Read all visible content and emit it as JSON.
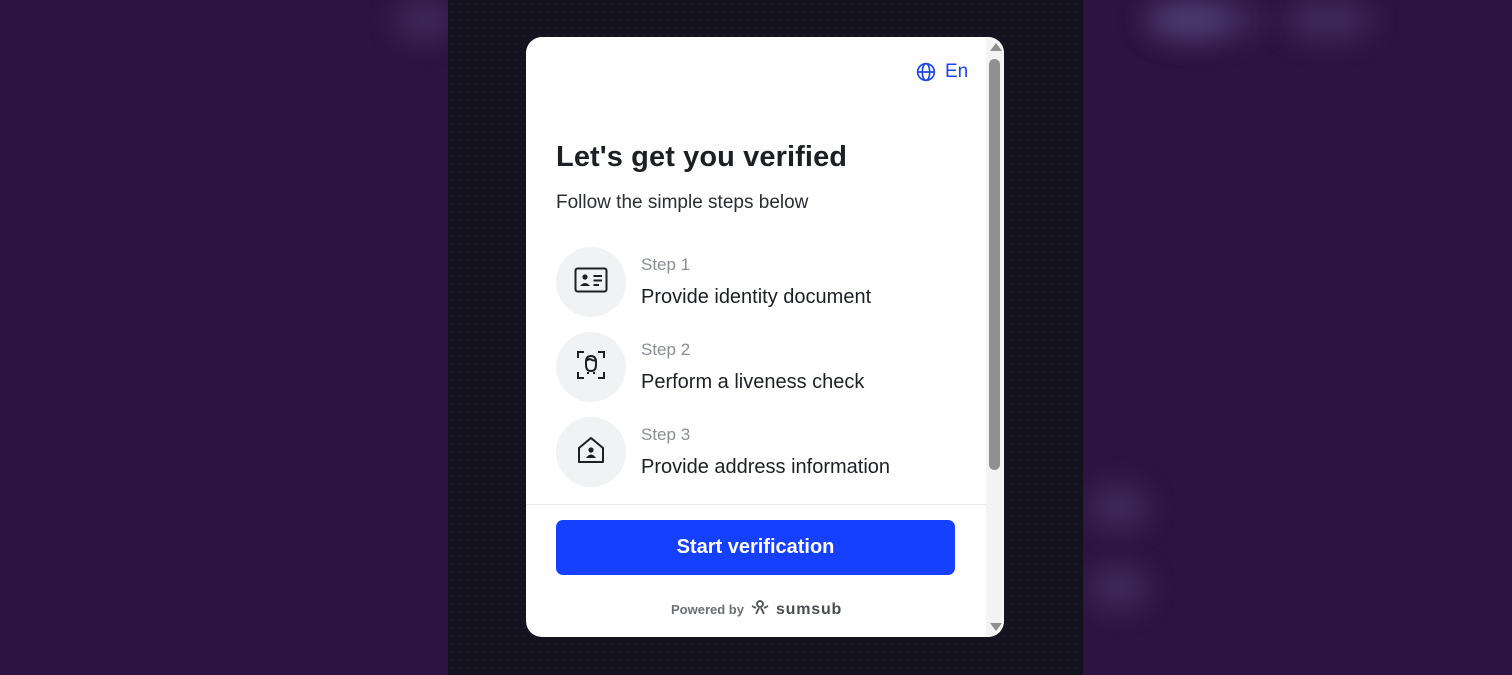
{
  "language": {
    "label": "En",
    "icon": "globe-icon"
  },
  "header": {
    "title": "Let's get you verified",
    "subtitle": "Follow the simple steps below"
  },
  "steps": [
    {
      "number": "Step 1",
      "label": "Provide identity document",
      "icon": "id-card-icon"
    },
    {
      "number": "Step 2",
      "label": "Perform a liveness check",
      "icon": "face-scan-icon"
    },
    {
      "number": "Step 3",
      "label": "Provide address information",
      "icon": "home-person-icon"
    }
  ],
  "actions": {
    "start_label": "Start verification"
  },
  "footer": {
    "powered_by": "Powered by",
    "brand": "sumsub"
  },
  "colors": {
    "accent": "#1540ff",
    "link": "#1a46e8",
    "backdrop": "#2d1342"
  }
}
